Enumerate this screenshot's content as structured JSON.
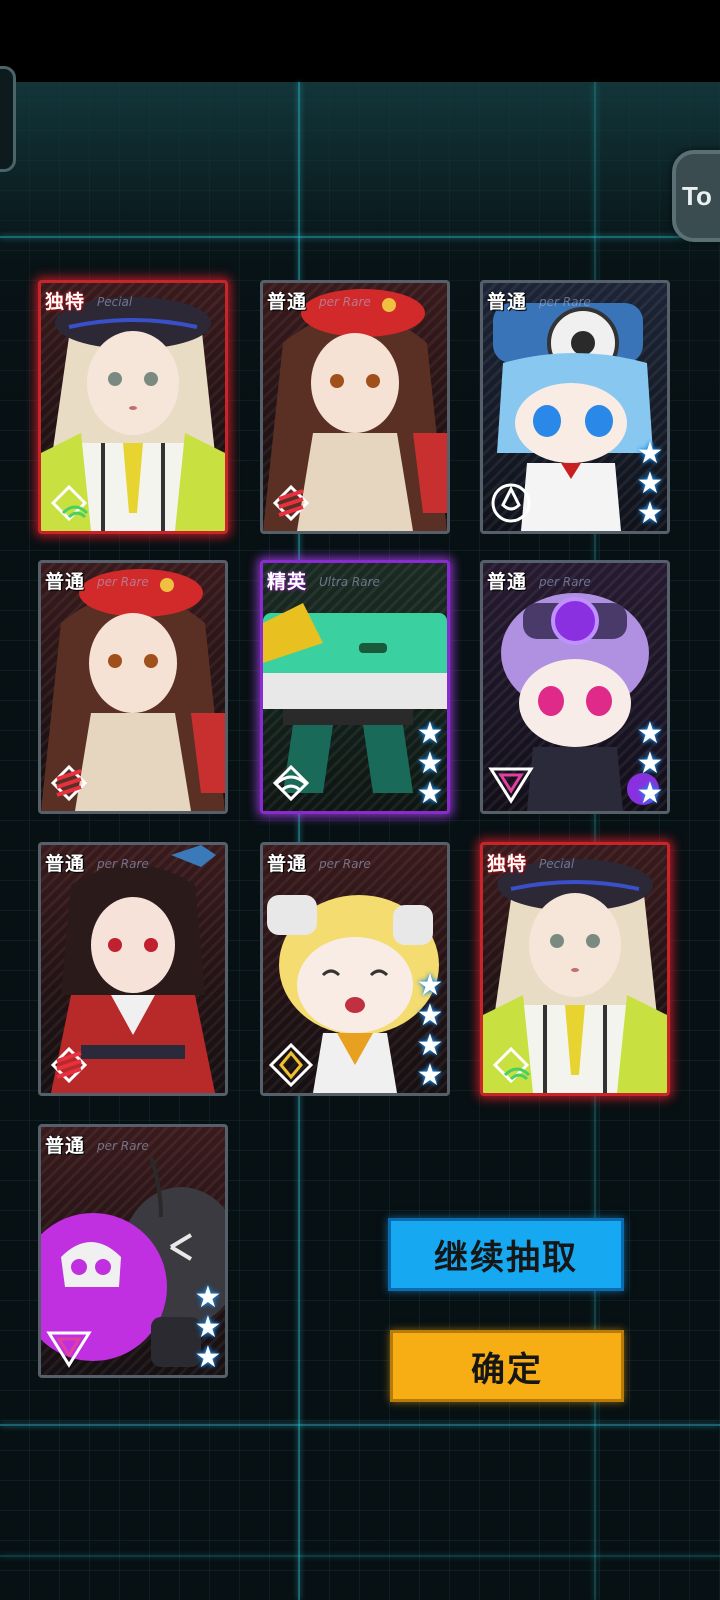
{
  "top_right_button": {
    "label": "To"
  },
  "cards": [
    {
      "rarity": "独特",
      "rarity_en": "Pecial",
      "tier": "special",
      "stars": 0,
      "faction": "wifi-icon",
      "character": "blonde-beret-girl"
    },
    {
      "rarity": "普通",
      "rarity_en": "per Rare",
      "tier": "normal",
      "stars": 0,
      "faction": "stripes-icon",
      "character": "brown-hair-red-beret-girl"
    },
    {
      "rarity": "普通",
      "rarity_en": "per Rare",
      "tier": "normal",
      "stars": 3,
      "faction": "drop-circle-icon",
      "character": "blue-hair-chibi-goggles"
    },
    {
      "rarity": "普通",
      "rarity_en": "per Rare",
      "tier": "normal",
      "stars": 0,
      "faction": "stripes-icon",
      "character": "brown-hair-red-beret-girl"
    },
    {
      "rarity": "精英",
      "rarity_en": "Ultra Rare",
      "tier": "ultra",
      "stars": 3,
      "faction": "wifi-icon",
      "character": "green-mech-weapon"
    },
    {
      "rarity": "普通",
      "rarity_en": "per Rare",
      "tier": "normal",
      "stars": 3,
      "faction": "triangle-icon",
      "character": "purple-hair-chibi"
    },
    {
      "rarity": "普通",
      "rarity_en": "per Rare",
      "tier": "normal",
      "stars": 0,
      "faction": "stripes-icon",
      "character": "black-hair-kimono-girl"
    },
    {
      "rarity": "普通",
      "rarity_en": "per Rare",
      "tier": "normal",
      "stars": 4,
      "faction": "diamond-icon",
      "character": "yellow-hair-chibi"
    },
    {
      "rarity": "独特",
      "rarity_en": "Pecial",
      "tier": "special",
      "stars": 0,
      "faction": "wifi-icon",
      "character": "blonde-beret-girl"
    },
    {
      "rarity": "普通",
      "rarity_en": "per Rare",
      "tier": "normal",
      "stars": 3,
      "faction": "triangle-icon",
      "character": "purple-skull-bomb"
    }
  ],
  "buttons": {
    "continue": "继续抽取",
    "confirm": "确定"
  },
  "colors": {
    "special_glow": "#c8252a",
    "ultra_glow": "#8a2bd0",
    "continue_bg": "#16a8f0",
    "confirm_bg": "#f7ad14",
    "grid_line": "#30c8d7"
  }
}
